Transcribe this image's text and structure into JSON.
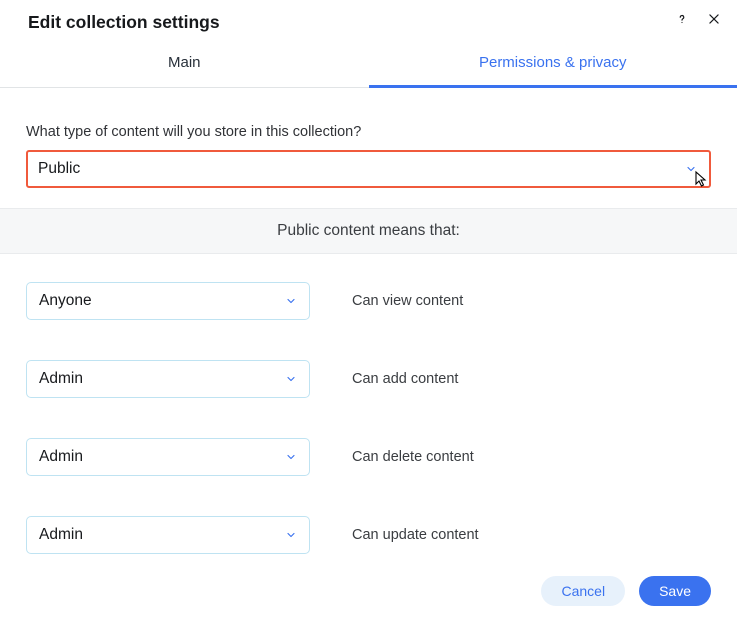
{
  "header": {
    "title": "Edit collection settings"
  },
  "tabs": {
    "main": "Main",
    "permissions": "Permissions & privacy"
  },
  "question_label": "What type of content will you store in this collection?",
  "content_type_select": {
    "value": "Public"
  },
  "info_band": "Public content means that:",
  "permissions": [
    {
      "role": "Anyone",
      "desc": "Can view content"
    },
    {
      "role": "Admin",
      "desc": "Can add content"
    },
    {
      "role": "Admin",
      "desc": "Can delete content"
    },
    {
      "role": "Admin",
      "desc": "Can update content"
    }
  ],
  "footer": {
    "cancel": "Cancel",
    "save": "Save"
  }
}
